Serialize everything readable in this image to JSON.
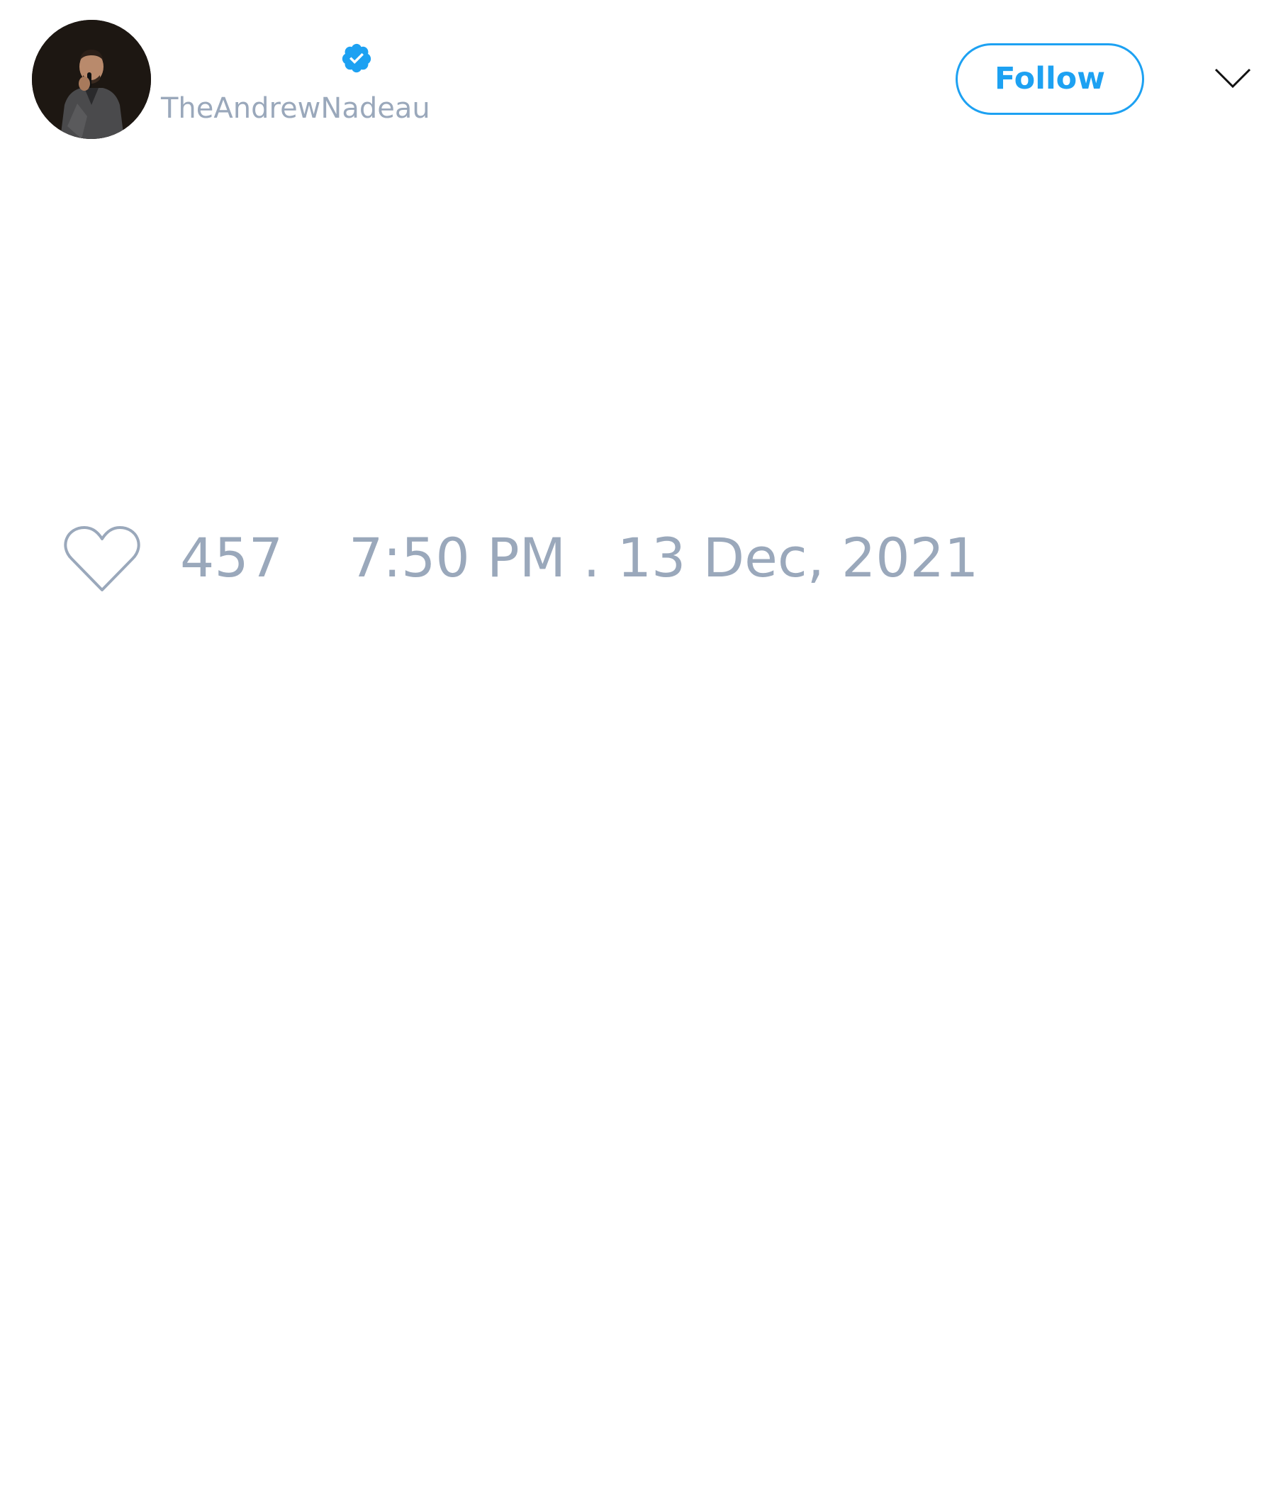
{
  "tweet": {
    "author": {
      "handle": "TheAndrewNadeau",
      "verified": true,
      "avatar_icon": "profile-photo"
    },
    "actions": {
      "follow_label": "Follow",
      "menu_icon": "chevron-down-icon"
    },
    "stats": {
      "like_icon": "heart-icon",
      "likes": "457",
      "timestamp": "7:50 PM . 13 Dec, 2021"
    },
    "colors": {
      "accent": "#1da1f2",
      "muted_text": "#9aa8bb",
      "background": "#ffffff"
    }
  }
}
